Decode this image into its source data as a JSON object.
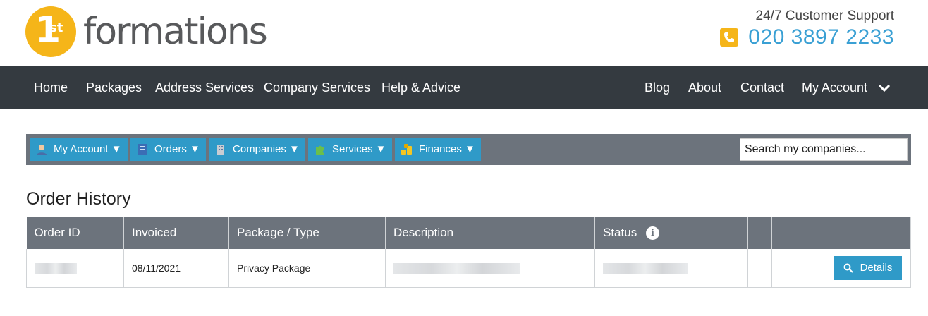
{
  "brand": {
    "logo_number": "1",
    "logo_suffix": "st",
    "logo_word": "formations"
  },
  "support": {
    "label": "24/7 Customer Support",
    "phone": "020 3897 2233"
  },
  "mainnav": {
    "left": [
      "Home",
      "Packages",
      "Address Services",
      "Company Services",
      "Help & Advice"
    ],
    "right": [
      "Blog",
      "About",
      "Contact",
      "My Account"
    ]
  },
  "toolbar": {
    "buttons": [
      {
        "label": "My Account ▼",
        "icon": "user-icon"
      },
      {
        "label": "Orders ▼",
        "icon": "document-icon"
      },
      {
        "label": "Companies ▼",
        "icon": "building-icon"
      },
      {
        "label": "Services ▼",
        "icon": "puzzle-icon"
      },
      {
        "label": "Finances ▼",
        "icon": "coins-icon"
      }
    ],
    "search_placeholder": "Search my companies..."
  },
  "page_title": "Order History",
  "table": {
    "headers": [
      "Order ID",
      "Invoiced",
      "Package / Type",
      "Description",
      "Status",
      "",
      ""
    ],
    "rows": [
      {
        "order_id": "",
        "invoiced": "08/11/2021",
        "package": "Privacy Package",
        "description": "",
        "status": "",
        "action": "Details"
      }
    ]
  },
  "colors": {
    "brand_yellow": "#f5b519",
    "accent_blue": "#2f9ac8",
    "nav_dark": "#343a40",
    "toolbar_grey": "#6c737c"
  }
}
